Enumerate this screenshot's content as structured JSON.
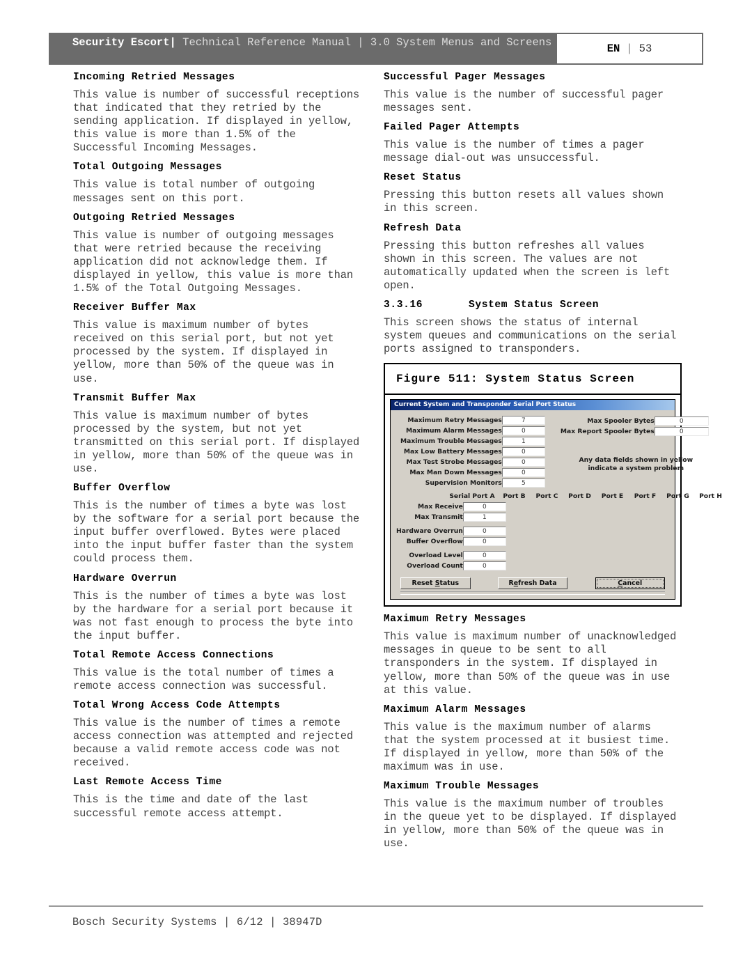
{
  "header": {
    "brand": "Security Escort",
    "sep": "|",
    "subtitle": "Technical Reference Manual | 3.0  System Menus and Screens",
    "lang": "EN",
    "page": "53"
  },
  "left_column": [
    {
      "heading": "Incoming Retried Messages",
      "body": "This value is number of successful receptions that indicated that they retried by the sending application. If displayed in yellow, this value is more than 1.5% of the Successful Incoming Messages."
    },
    {
      "heading": "Total Outgoing Messages",
      "body": "This value is total number of outgoing messages sent on this port."
    },
    {
      "heading": "Outgoing Retried Messages",
      "body": "This value is number of outgoing messages that were retried because the receiving application did not acknowledge them. If displayed in yellow, this value is more than 1.5% of the Total Outgoing Messages."
    },
    {
      "heading": "Receiver Buffer Max",
      "body": "This value is maximum number of bytes received on this serial port, but not yet processed by the system. If displayed in yellow, more than 50% of the queue was in use."
    },
    {
      "heading": "Transmit Buffer Max",
      "body": "This value is maximum number of bytes processed by the system, but not yet transmitted on this serial port. If displayed in yellow, more than 50% of the queue was in use."
    },
    {
      "heading": "Buffer Overflow",
      "body": "This is the number of times a byte was lost by the software for a serial port because the input buffer overflowed. Bytes were placed into the input buffer faster than the system could process them."
    },
    {
      "heading": "Hardware Overrun",
      "body": "This is the number of times a byte was lost by the hardware for a serial port because it was not fast enough to process the byte into the input buffer."
    },
    {
      "heading": "Total Remote Access Connections",
      "body": "This value is the total number of times a remote access connection was successful."
    },
    {
      "heading": "Total Wrong Access Code Attempts",
      "body": "This value is the number of times a remote access connection was attempted and rejected because a valid remote access code was not received."
    },
    {
      "heading": "Last Remote Access Time",
      "body": "This is the time and date of the last successful remote access attempt."
    }
  ],
  "right_column_top": [
    {
      "heading": "Successful Pager Messages",
      "body": "This value is the number of successful pager messages sent."
    },
    {
      "heading": "Failed Pager Attempts",
      "body": "This value is the number of times a pager message dial-out was unsuccessful."
    },
    {
      "heading": "Reset Status",
      "body": "Pressing this button resets all values shown in this screen."
    },
    {
      "heading": "Refresh Data",
      "body": "Pressing this button refreshes all values shown in this screen. The values are not automatically updated when the screen is left open."
    }
  ],
  "section": {
    "number": "3.3.16",
    "title": "System Status Screen",
    "body": "This screen shows the status of internal system queues and communications on the serial ports assigned to transponders."
  },
  "figure": {
    "caption": "Figure 511: System Status Screen",
    "dialog": {
      "title": "Current System and Transponder Serial Port Status",
      "left_fields": [
        {
          "label": "Maximum Retry Messages",
          "value": "7"
        },
        {
          "label": "Maximum Alarm Messages",
          "value": "0"
        },
        {
          "label": "Maximum Trouble Messages",
          "value": "1"
        },
        {
          "label": "Max Low Battery Messages",
          "value": "0"
        },
        {
          "label": "Max Test Strobe Messages",
          "value": "0"
        },
        {
          "label": "Max Man Down Messages",
          "value": "0"
        },
        {
          "label": "Supervision Monitors",
          "value": "5"
        }
      ],
      "right_fields": [
        {
          "label": "Max Spooler Bytes",
          "value": "0"
        },
        {
          "label": "Max Report Spooler Bytes",
          "value": "0"
        }
      ],
      "note_line1": "Any data fields shown in yellow",
      "note_line2": "indicate a system problem",
      "port_headers": [
        "Serial Port A",
        "Port B",
        "Port C",
        "Port D",
        "Port E",
        "Port F",
        "Port G",
        "Port H"
      ],
      "port_rows": [
        {
          "label": "Max Receive",
          "value": "0"
        },
        {
          "label": "Max Transmit",
          "value": "1"
        },
        {
          "label": "Hardware Overrun",
          "value": "0"
        },
        {
          "label": "Buffer Overflow",
          "value": "0"
        },
        {
          "label": "Overload Level",
          "value": "0"
        },
        {
          "label": "Overload Count",
          "value": "0"
        }
      ],
      "buttons": [
        {
          "pre": "Reset ",
          "accel": "S",
          "post": "tatus"
        },
        {
          "pre": "R",
          "accel": "e",
          "post": "fresh Data"
        },
        {
          "pre": "",
          "accel": "C",
          "post": "ancel"
        }
      ],
      "colors": {
        "face": "#d4d0c8",
        "title_start": "#0a246a",
        "title_end": "#a6c8ec",
        "field_bg": "#ffffff"
      }
    }
  },
  "right_column_bottom": [
    {
      "heading": "Maximum Retry Messages",
      "body": "This value is maximum number of unacknowledged messages in queue to be sent to all transponders in the system. If displayed in yellow, more than 50% of the queue was in use at this value."
    },
    {
      "heading": "Maximum Alarm Messages",
      "body": "This value is the maximum number of alarms that the system processed at it busiest time. If displayed in yellow, more than 50% of the maximum was in use."
    },
    {
      "heading": "Maximum Trouble Messages",
      "body": "This value is the maximum number of troubles in the queue yet to be displayed. If displayed in yellow, more than 50% of the queue was in use."
    }
  ],
  "footer": {
    "text": "Bosch Security Systems | 6/12 | 38947D"
  }
}
